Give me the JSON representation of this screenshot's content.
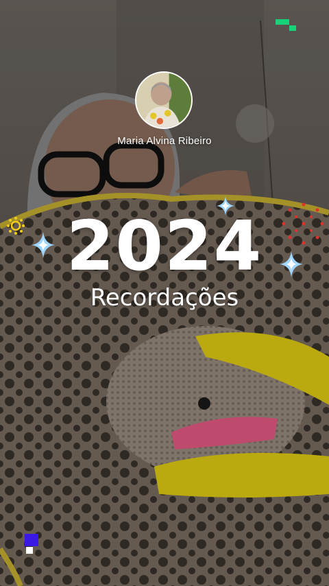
{
  "profile": {
    "name": "Maria Alvina Ribeiro"
  },
  "memories": {
    "year": "2024",
    "title": "Recordações"
  },
  "colors": {
    "accent_green": "#16d37a",
    "accent_blue": "#3a19e6",
    "spark_blue": "#9fd6ff",
    "yellow": "#f2cc18",
    "red_dots": "#e0322c"
  },
  "icons": [
    "sparkle-icon",
    "sun-icon",
    "firework-icon",
    "badge-icon"
  ]
}
